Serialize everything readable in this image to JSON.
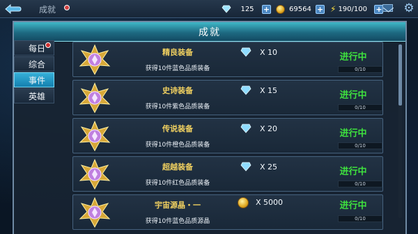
{
  "header": {
    "title": "成就",
    "gems": "125",
    "coins": "69564",
    "energy": "190/100"
  },
  "panel": {
    "title": "成就"
  },
  "tabs": [
    {
      "label": "每日",
      "has_dot": true,
      "active": false
    },
    {
      "label": "综合",
      "has_dot": false,
      "active": false
    },
    {
      "label": "事件",
      "has_dot": false,
      "active": true
    },
    {
      "label": "英雄",
      "has_dot": false,
      "active": false
    }
  ],
  "achievements": [
    {
      "title": "精良装备",
      "desc": "获得10件蓝色品质装备",
      "reward_type": "gem",
      "reward_qty": "X 10",
      "status": "进行中",
      "progress_text": "0/10",
      "progress": 0
    },
    {
      "title": "史诗装备",
      "desc": "获得10件紫色品质装备",
      "reward_type": "gem",
      "reward_qty": "X 15",
      "status": "进行中",
      "progress_text": "0/10",
      "progress": 0
    },
    {
      "title": "传说装备",
      "desc": "获得10件橙色品质装备",
      "reward_type": "gem",
      "reward_qty": "X 20",
      "status": "进行中",
      "progress_text": "0/10",
      "progress": 0
    },
    {
      "title": "超越装备",
      "desc": "获得10件红色品质装备",
      "reward_type": "gem",
      "reward_qty": "X 25",
      "status": "进行中",
      "progress_text": "0/10",
      "progress": 0
    },
    {
      "title": "宇宙源晶・一",
      "desc": "获得10件蓝色品质源晶",
      "reward_type": "coin",
      "reward_qty": "X 5000",
      "status": "进行中",
      "progress_text": "0/10",
      "progress": 0
    }
  ],
  "colors": {
    "status_green": "#3ee03e",
    "title_gold": "#f0d060",
    "header_cyan": "#1e6a82"
  }
}
